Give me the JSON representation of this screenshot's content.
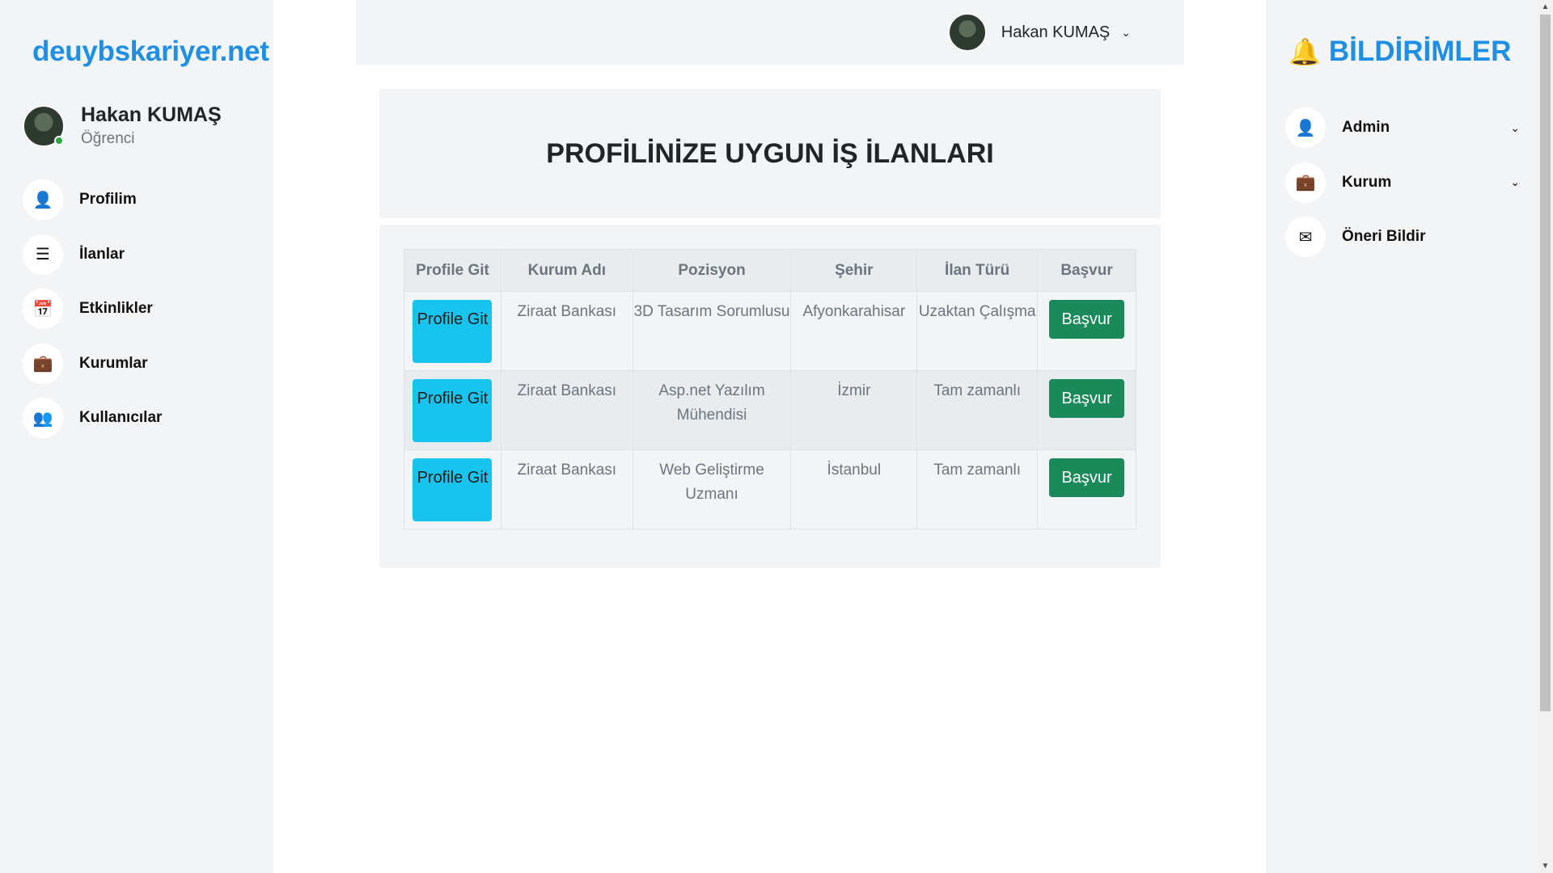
{
  "brand": "deuybskariyer.net",
  "user": {
    "name": "Hakan KUMAŞ",
    "role": "Öğrenci"
  },
  "nav": [
    {
      "label": "Profilim",
      "icon": "user-icon",
      "glyph": "👤"
    },
    {
      "label": "İlanlar",
      "icon": "list-icon",
      "glyph": "☰"
    },
    {
      "label": "Etkinlikler",
      "icon": "calendar-icon",
      "glyph": "📅"
    },
    {
      "label": "Kurumlar",
      "icon": "briefcase-icon",
      "glyph": "💼"
    },
    {
      "label": "Kullanıcılar",
      "icon": "users-icon",
      "glyph": "👥"
    }
  ],
  "topbar": {
    "username": "Hakan KUMAŞ",
    "chevron": "⌄"
  },
  "main": {
    "title": "PROFİLİNİZE UYGUN İŞ İLANLARI",
    "table": {
      "headers": [
        "Profile Git",
        "Kurum Adı",
        "Pozisyon",
        "Şehir",
        "İlan Türü",
        "Başvur"
      ],
      "rows": [
        {
          "profile_btn": "Profile Git",
          "company": "Ziraat Bankası",
          "position": "3D Tasarım Sorumlusu",
          "city": "Afyonkarahisar",
          "type": "Uzaktan Çalışma",
          "apply_btn": "Başvur"
        },
        {
          "profile_btn": "Profile Git",
          "company": "Ziraat Bankası",
          "position": "Asp.net Yazılım Mühendisi",
          "city": "İzmir",
          "type": "Tam zamanlı",
          "apply_btn": "Başvur"
        },
        {
          "profile_btn": "Profile Git",
          "company": "Ziraat Bankası",
          "position": "Web Geliştirme Uzmanı",
          "city": "İstanbul",
          "type": "Tam zamanlı",
          "apply_btn": "Başvur"
        }
      ]
    }
  },
  "notifications": {
    "title": "BİLDİRİMLER",
    "items": [
      {
        "label": "Admin",
        "icon": "user-icon",
        "glyph": "👤",
        "has_dropdown": true
      },
      {
        "label": "Kurum",
        "icon": "briefcase-icon",
        "glyph": "💼",
        "has_dropdown": true
      },
      {
        "label": "Öneri Bildir",
        "icon": "envelope-icon",
        "glyph": "✉",
        "has_dropdown": false
      }
    ]
  },
  "colors": {
    "brand": "#1f8fe6",
    "profile_button": "#17c4ee",
    "apply_button": "#1a8a5a",
    "online": "#28a745"
  }
}
